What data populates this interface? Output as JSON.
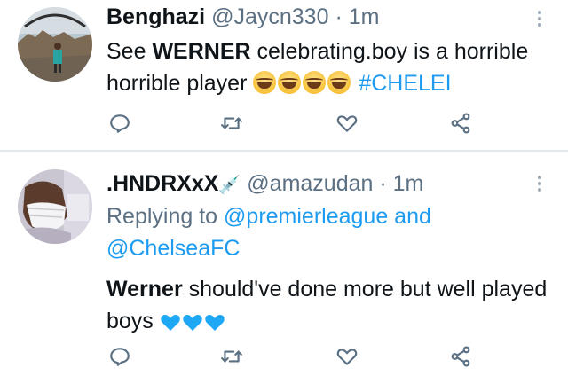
{
  "tweets": [
    {
      "name": "Benghazi",
      "handle": "@Jaycn330",
      "separator": "·",
      "time": "1m",
      "text_before": "See ",
      "text_bold": "WERNER",
      "text_after": " celebrating.boy is a horrible horrible player ",
      "emoji": "😂😂😂😂",
      "hashtag": "#CHELEI"
    },
    {
      "name": ".HNDRXxX",
      "name_emoji": "💉",
      "handle": "@amazudan",
      "separator": "·",
      "time": "1m",
      "reply_prefix": "Replying to ",
      "reply_user1": "@premierleague",
      "reply_and": " and",
      "reply_user2": "@ChelseaFC",
      "text_bold": "Werner",
      "text_after": " should've done more but well played boys ",
      "emoji": "💙💙💙"
    }
  ],
  "icons": {
    "reply": "reply-icon",
    "retweet": "retweet-icon",
    "like": "like-icon",
    "share": "share-icon",
    "more": "more-icon"
  },
  "colors": {
    "link": "#1d9bf0",
    "secondary": "#5b7083",
    "text": "#0f1419",
    "divider": "#e3e8ec",
    "blue_heart": "#1ea7f5"
  }
}
